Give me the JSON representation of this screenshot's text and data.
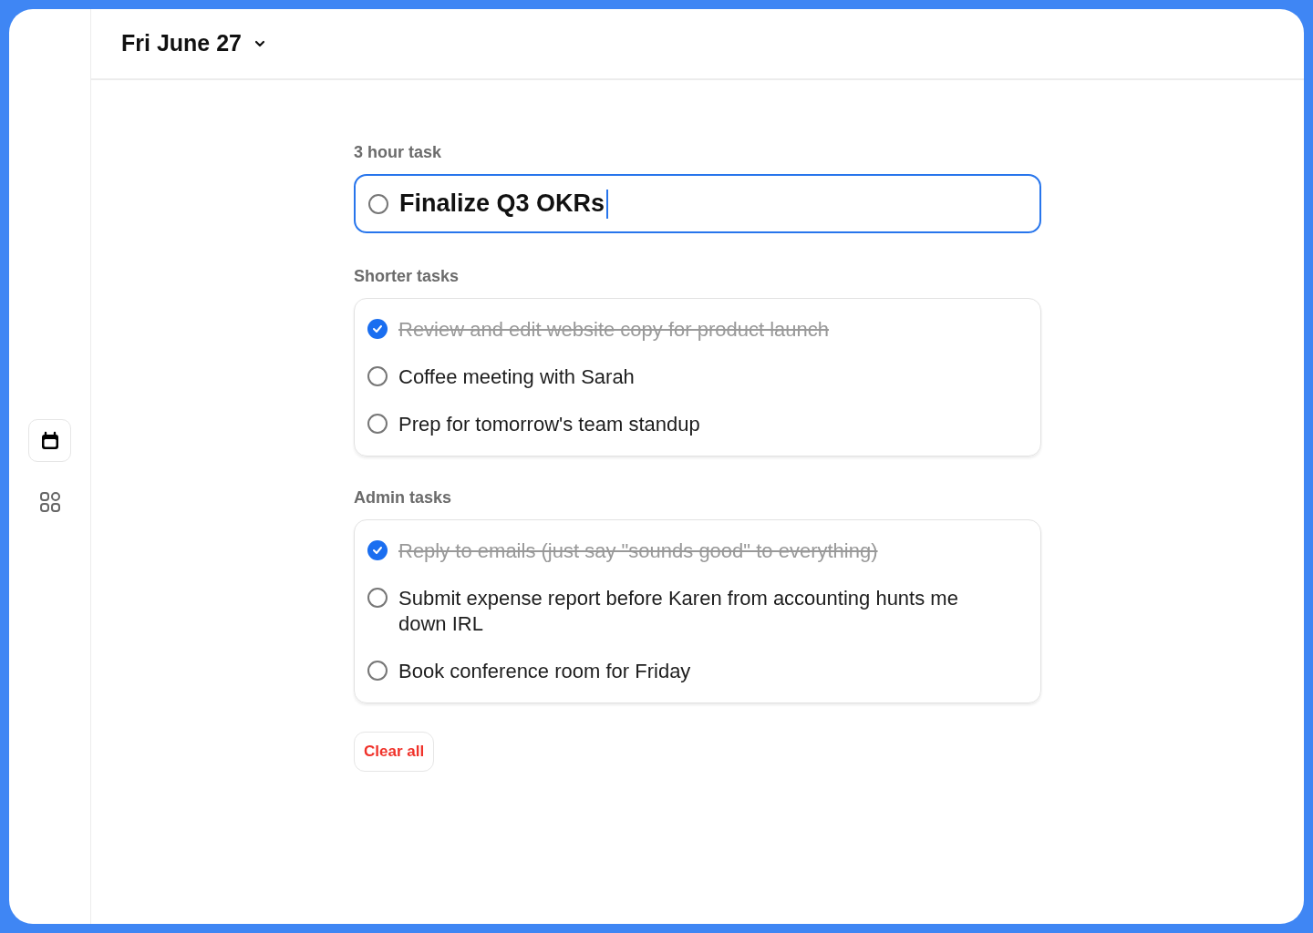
{
  "header": {
    "date": "Fri June 27"
  },
  "sidebar": {
    "items": [
      {
        "kind": "calendar",
        "selected": true
      },
      {
        "kind": "apps",
        "selected": false
      }
    ]
  },
  "main_task": {
    "label": "3 hour task",
    "value": "Finalize Q3 OKRs",
    "checked": false,
    "focused": true
  },
  "groups": [
    {
      "label": "Shorter tasks",
      "tasks": [
        {
          "text": "Review and edit website copy for product launch",
          "checked": true
        },
        {
          "text": "Coffee meeting with Sarah",
          "checked": false
        },
        {
          "text": "Prep for tomorrow's team standup",
          "checked": false
        }
      ]
    },
    {
      "label": "Admin tasks",
      "tasks": [
        {
          "text": "Reply to emails (just say \"sounds good\" to everything)",
          "checked": true
        },
        {
          "text": "Submit expense report before Karen from accounting hunts me down IRL",
          "checked": false
        },
        {
          "text": "Book conference room for Friday",
          "checked": false
        }
      ]
    }
  ],
  "clear_button": "Clear all"
}
